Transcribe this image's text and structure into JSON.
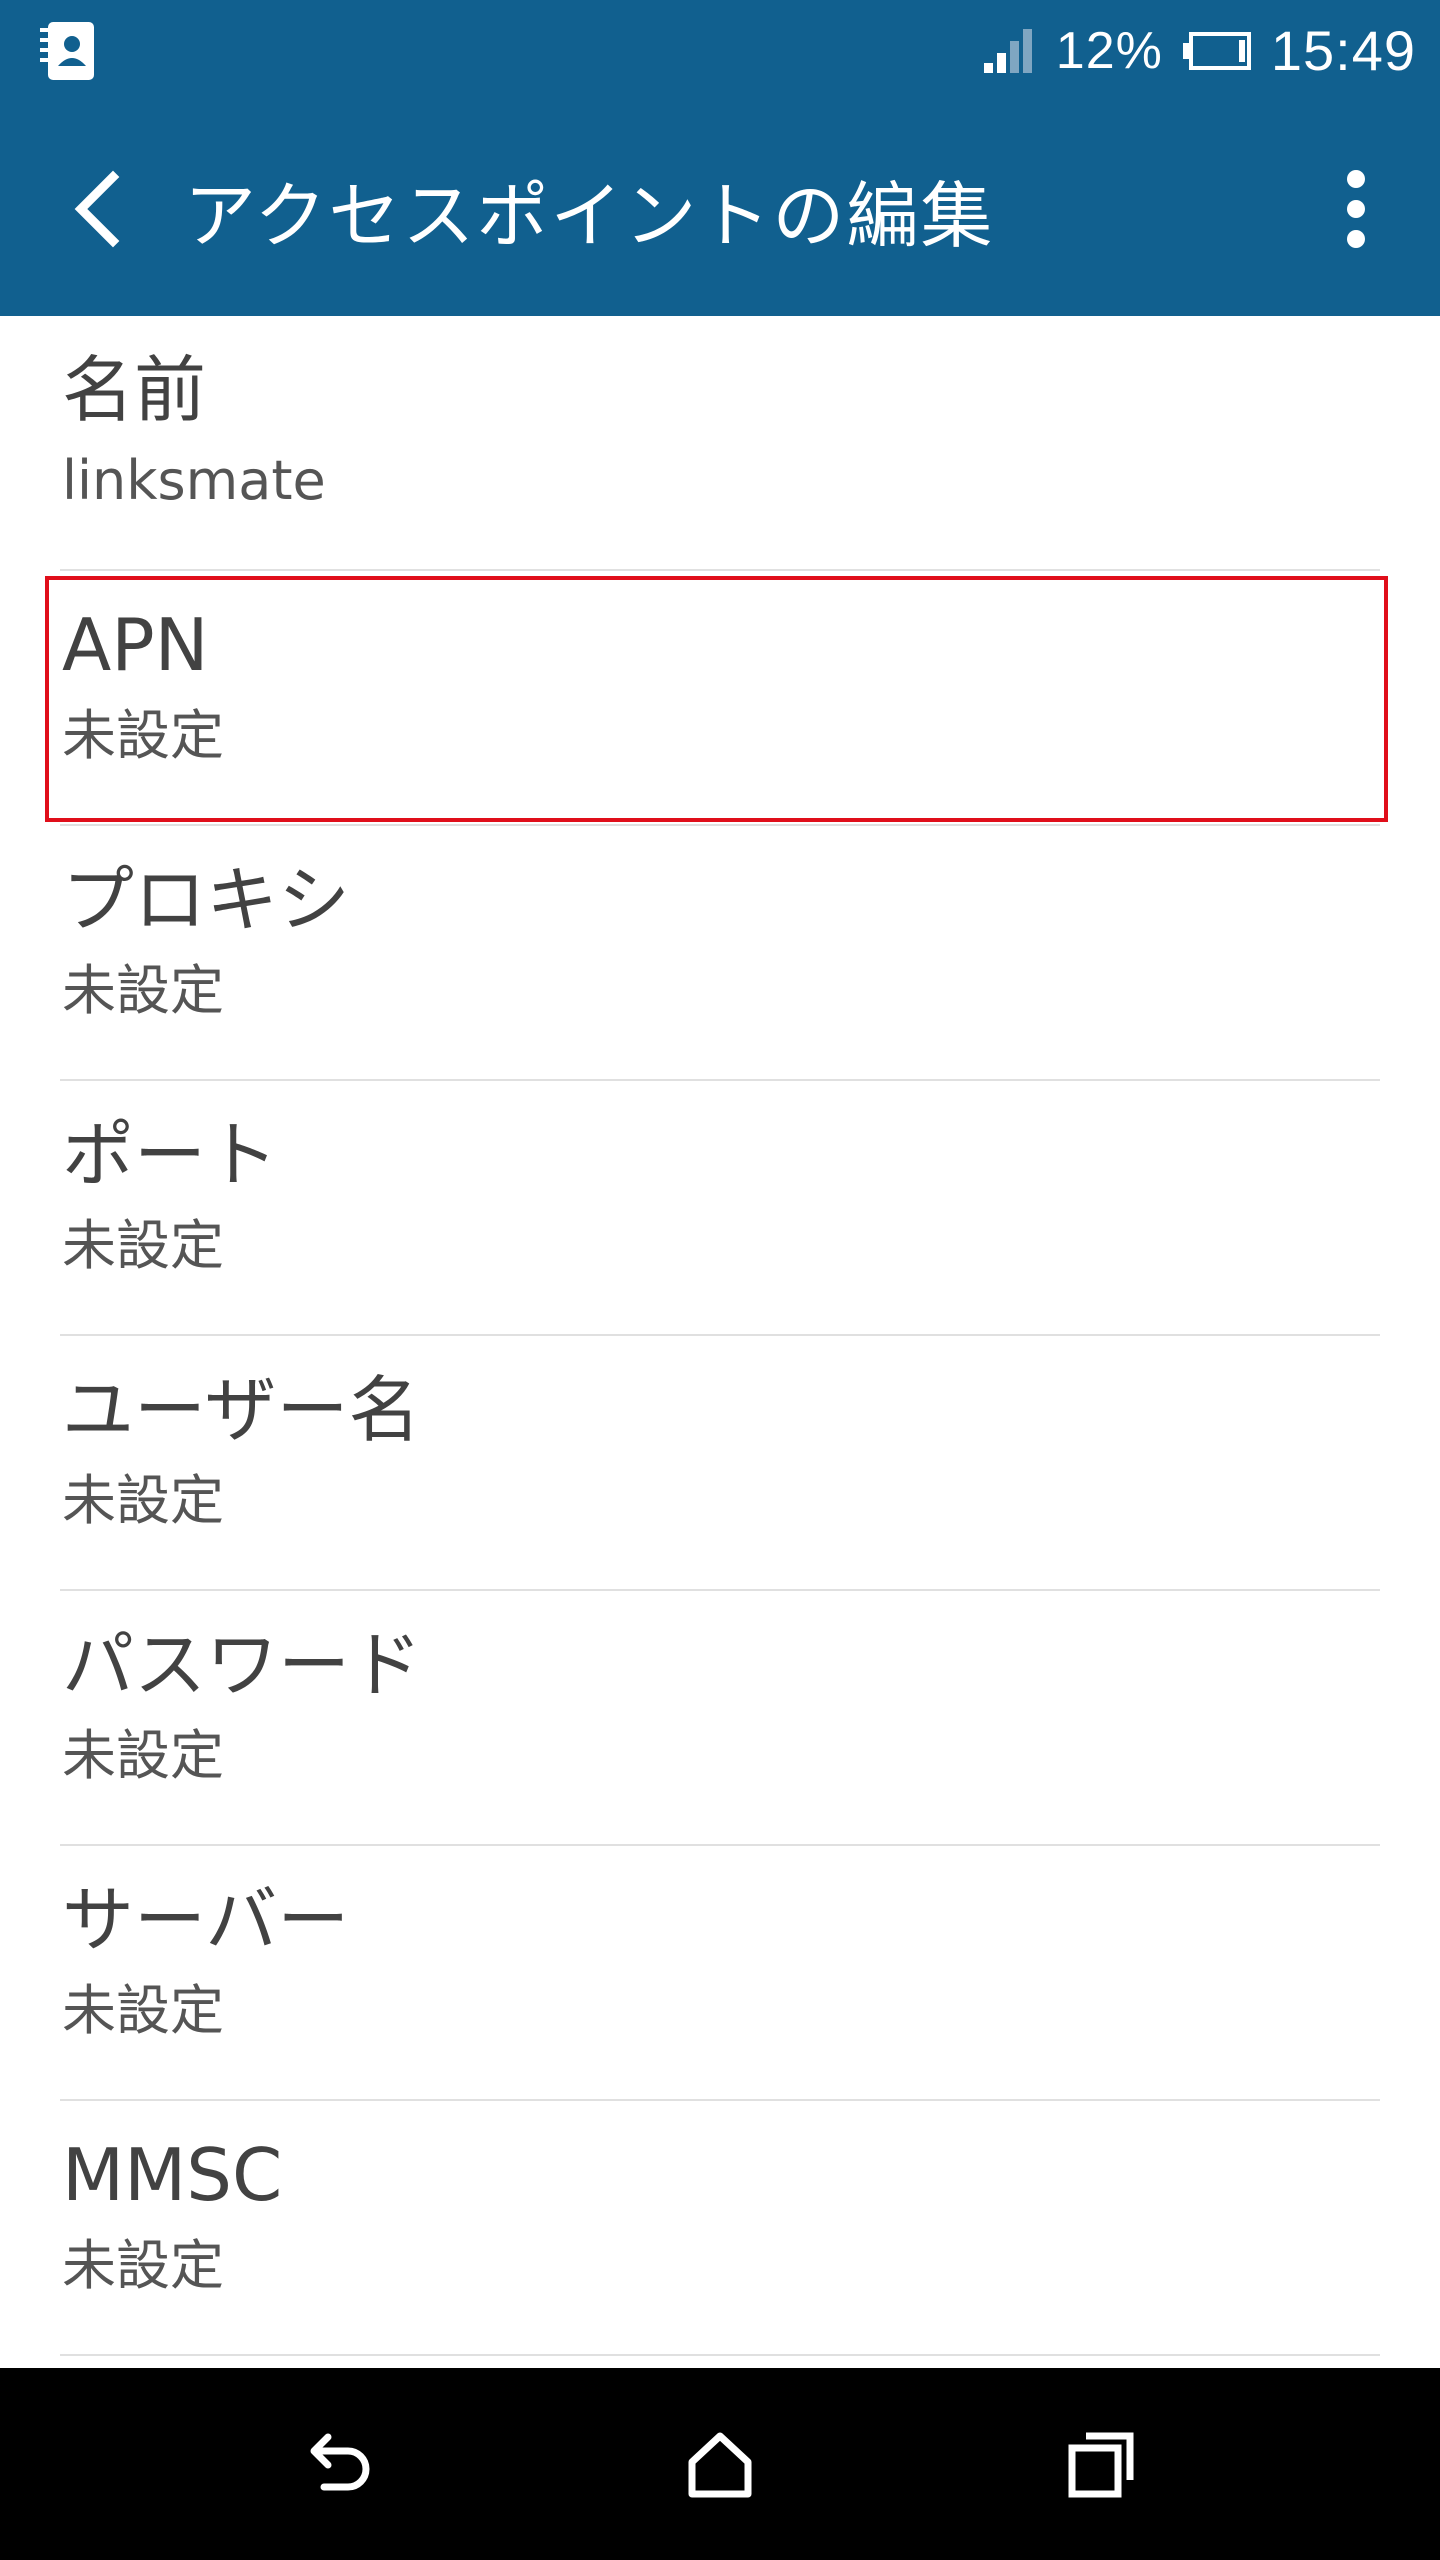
{
  "status_bar": {
    "left_icon": "contacts-notification-icon",
    "signal_icon": "signal-icon",
    "battery_percent": "12%",
    "battery_icon": "battery-icon",
    "time": "15:49"
  },
  "app_bar": {
    "back_icon": "chevron-left-icon",
    "title": "アクセスポイントの編集",
    "overflow_icon": "more-vert-icon"
  },
  "list": {
    "items": [
      {
        "title": "名前",
        "value": "linksmate"
      },
      {
        "title": "APN",
        "value": "未設定",
        "highlighted": true
      },
      {
        "title": "プロキシ",
        "value": "未設定"
      },
      {
        "title": "ポート",
        "value": "未設定"
      },
      {
        "title": "ユーザー名",
        "value": "未設定"
      },
      {
        "title": "パスワード",
        "value": "未設定"
      },
      {
        "title": "サーバー",
        "value": "未設定"
      },
      {
        "title": "MMSC",
        "value": "未設定"
      }
    ]
  },
  "nav_bar": {
    "back_icon": "back-arrow-icon",
    "home_icon": "home-icon",
    "recent_icon": "recent-apps-icon"
  },
  "colors": {
    "primary": "#11608f",
    "highlight": "#e00e1a",
    "text": "#424242",
    "divider": "#e0e0e0",
    "nav_bar": "#000000"
  }
}
